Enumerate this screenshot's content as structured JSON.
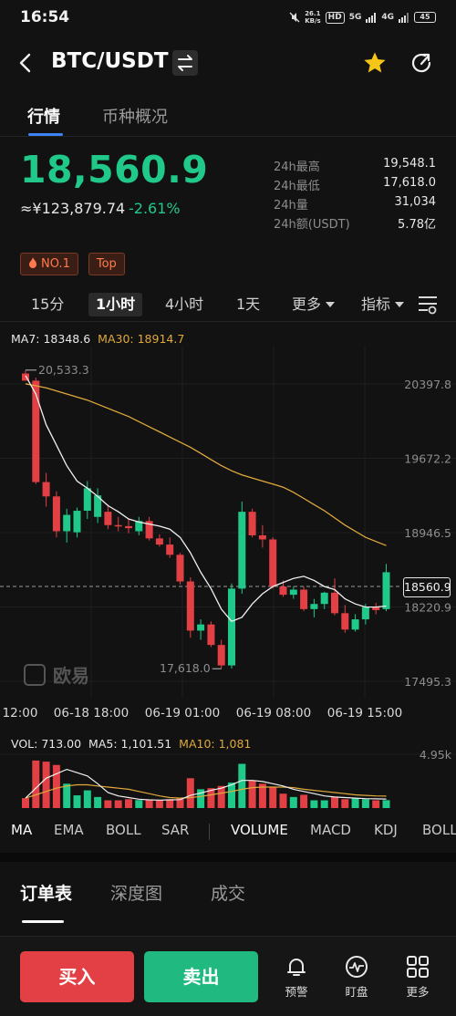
{
  "status_bar": {
    "time": "16:54",
    "net_speed": "26.1",
    "net_unit": "KB/s",
    "hd": "HD",
    "signal1": "5G",
    "signal2": "4G",
    "battery": "45"
  },
  "header": {
    "title": "BTC/USDT",
    "back_icon": "chevron-left-icon",
    "swap_icon": "swap-icon",
    "favorite_icon": "star-icon",
    "share_icon": "share-icon",
    "accent": "#f5c518"
  },
  "tabs": [
    {
      "label": "行情",
      "active": true
    },
    {
      "label": "币种概况",
      "active": false
    }
  ],
  "ticker": {
    "price": "18,560.9",
    "cny": "≈¥123,879.74",
    "change": "-2.61%",
    "up_color": "#20c98a",
    "down_color": "#e24045",
    "stats": [
      {
        "key": "24h最高",
        "value": "19,548.1"
      },
      {
        "key": "24h最低",
        "value": "17,618.0"
      },
      {
        "key": "24h量",
        "value": "31,034"
      },
      {
        "key": "24h额(USDT)",
        "value": "5.78亿"
      }
    ],
    "badges": [
      "NO.1",
      "Top"
    ]
  },
  "intervals": {
    "items": [
      "15分",
      "1小时",
      "4小时",
      "1天"
    ],
    "active": "1小时",
    "more": "更多",
    "indicators": "指标"
  },
  "chart_data": {
    "type": "candlestick",
    "ma_legend": {
      "ma7": "MA7: 18348.6",
      "ma30": "MA30: 18914.7"
    },
    "y_ticks": [
      "20397.8",
      "19672.2",
      "18946.5",
      "18220.9",
      "17495.3"
    ],
    "y_tick_values": [
      20397.8,
      19672.2,
      18946.5,
      18220.9,
      17495.3
    ],
    "x_ticks": [
      "12:00",
      "06-18 18:00",
      "06-19 01:00",
      "06-19 08:00",
      "06-19 15:00"
    ],
    "high_label": "20,533.3",
    "low_label": "17,618.0",
    "current_price_label": "18560.9",
    "candles": [
      {
        "o": 20500,
        "h": 20533,
        "l": 20450,
        "c": 20430
      },
      {
        "o": 20430,
        "h": 20460,
        "l": 19420,
        "c": 19440
      },
      {
        "o": 19440,
        "h": 19530,
        "l": 19200,
        "c": 19300
      },
      {
        "o": 19300,
        "h": 19350,
        "l": 18900,
        "c": 18960
      },
      {
        "o": 18960,
        "h": 19180,
        "l": 18850,
        "c": 19120
      },
      {
        "o": 18950,
        "h": 19190,
        "l": 18900,
        "c": 19160
      },
      {
        "o": 19160,
        "h": 19450,
        "l": 19080,
        "c": 19380
      },
      {
        "o": 19100,
        "h": 19380,
        "l": 19040,
        "c": 19310
      },
      {
        "o": 19150,
        "h": 19220,
        "l": 18980,
        "c": 19020
      },
      {
        "o": 19020,
        "h": 19100,
        "l": 18960,
        "c": 19010
      },
      {
        "o": 19010,
        "h": 19080,
        "l": 18940,
        "c": 18990
      },
      {
        "o": 18960,
        "h": 19100,
        "l": 18920,
        "c": 19060
      },
      {
        "o": 19060,
        "h": 19100,
        "l": 18870,
        "c": 18890
      },
      {
        "o": 18890,
        "h": 18930,
        "l": 18810,
        "c": 18830
      },
      {
        "o": 18830,
        "h": 18900,
        "l": 18700,
        "c": 18730
      },
      {
        "o": 18730,
        "h": 18750,
        "l": 18440,
        "c": 18470
      },
      {
        "o": 18470,
        "h": 18510,
        "l": 17920,
        "c": 17990
      },
      {
        "o": 17990,
        "h": 18100,
        "l": 17900,
        "c": 18050
      },
      {
        "o": 18050,
        "h": 18080,
        "l": 17830,
        "c": 17850
      },
      {
        "o": 17850,
        "h": 17900,
        "l": 17618,
        "c": 17650
      },
      {
        "o": 17650,
        "h": 18450,
        "l": 17620,
        "c": 18400
      },
      {
        "o": 18400,
        "h": 19250,
        "l": 18350,
        "c": 19150
      },
      {
        "o": 19150,
        "h": 19180,
        "l": 18900,
        "c": 18920
      },
      {
        "o": 18920,
        "h": 19020,
        "l": 18800,
        "c": 18880
      },
      {
        "o": 18880,
        "h": 18900,
        "l": 18400,
        "c": 18420
      },
      {
        "o": 18420,
        "h": 18480,
        "l": 18320,
        "c": 18340
      },
      {
        "o": 18340,
        "h": 18420,
        "l": 18300,
        "c": 18390
      },
      {
        "o": 18390,
        "h": 18420,
        "l": 18180,
        "c": 18200
      },
      {
        "o": 18200,
        "h": 18300,
        "l": 18120,
        "c": 18250
      },
      {
        "o": 18250,
        "h": 18370,
        "l": 18200,
        "c": 18360
      },
      {
        "o": 18360,
        "h": 18500,
        "l": 18140,
        "c": 18160
      },
      {
        "o": 18160,
        "h": 18240,
        "l": 17970,
        "c": 18000
      },
      {
        "o": 18000,
        "h": 18150,
        "l": 17980,
        "c": 18100
      },
      {
        "o": 18100,
        "h": 18250,
        "l": 18050,
        "c": 18220
      },
      {
        "o": 18220,
        "h": 18260,
        "l": 18150,
        "c": 18190
      },
      {
        "o": 18200,
        "h": 18640,
        "l": 18180,
        "c": 18560
      }
    ],
    "ma7": [
      20480,
      20300,
      20000,
      19800,
      19600,
      19450,
      19380,
      19300,
      19210,
      19150,
      19080,
      19050,
      19030,
      19010,
      18980,
      18900,
      18750,
      18560,
      18400,
      18200,
      18080,
      18120,
      18250,
      18350,
      18420,
      18460,
      18500,
      18520,
      18480,
      18420,
      18390,
      18300,
      18250,
      18220,
      18220,
      18230
    ],
    "ma30": [
      20400,
      20380,
      20360,
      20330,
      20300,
      20270,
      20240,
      20200,
      20160,
      20120,
      20080,
      20030,
      19980,
      19930,
      19880,
      19830,
      19780,
      19720,
      19660,
      19600,
      19550,
      19510,
      19480,
      19450,
      19420,
      19390,
      19340,
      19280,
      19220,
      19160,
      19090,
      19020,
      18960,
      18900,
      18860,
      18820
    ],
    "volume": {
      "legend_vol": "VOL: 713.00",
      "legend_ma5": "MA5: 1,101.51",
      "legend_ma10": "MA10: 1,081",
      "y_tick": "4.95k",
      "ymax": 4950,
      "values": [
        900,
        4300,
        4200,
        3900,
        2200,
        1150,
        1600,
        1000,
        700,
        700,
        800,
        720,
        750,
        700,
        800,
        900,
        2700,
        1700,
        1800,
        2000,
        2300,
        4000,
        2500,
        2200,
        1900,
        1300,
        1000,
        1200,
        700,
        700,
        1000,
        800,
        900,
        800,
        700,
        713
      ],
      "ma5": [
        900,
        1800,
        2700,
        3100,
        3500,
        3200,
        2900,
        2200,
        1400,
        1100,
        950,
        800,
        740,
        720,
        740,
        760,
        1150,
        1350,
        1600,
        1800,
        2100,
        2500,
        2500,
        2400,
        2200,
        2000,
        1700,
        1500,
        1300,
        1100,
        1000,
        950,
        900,
        850,
        830,
        820
      ],
      "ma10": [
        900,
        1200,
        1500,
        1800,
        2000,
        2100,
        2100,
        2000,
        1900,
        1800,
        1700,
        1500,
        1300,
        1100,
        950,
        900,
        950,
        1050,
        1200,
        1350,
        1500,
        1700,
        1850,
        1900,
        1900,
        1900,
        1850,
        1700,
        1600,
        1500,
        1400,
        1300,
        1200,
        1150,
        1100,
        1081
      ]
    }
  },
  "watermark": "欧易",
  "indicator_tabs": [
    "MA",
    "EMA",
    "BOLL",
    "SAR",
    "VOLUME",
    "MACD",
    "KDJ",
    "BOLL"
  ],
  "order_tabs": [
    "订单表",
    "深度图",
    "成交"
  ],
  "bottom_bar": {
    "buy": "买入",
    "sell": "卖出",
    "alert": "预警",
    "watch": "盯盘",
    "more": "更多"
  }
}
